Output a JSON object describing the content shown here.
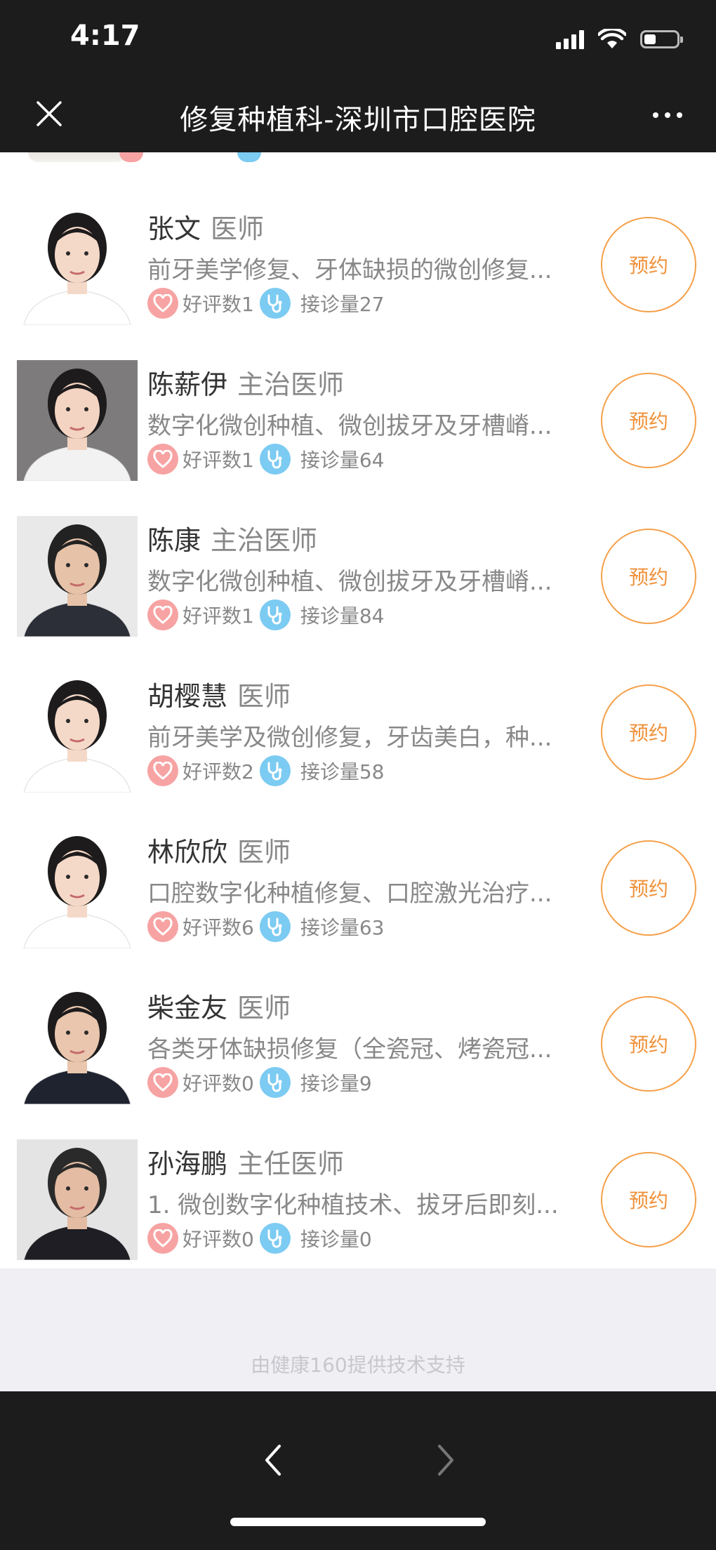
{
  "status_bar": {
    "time": "4:17"
  },
  "nav": {
    "title": "修复种植科-深圳市口腔医院"
  },
  "doctors": [
    {
      "name": "张文",
      "title": "医师",
      "specialty": "前牙美学修复、牙体缺损的微创修复...",
      "good_reviews": "好评数1",
      "visits": "接诊量27",
      "book": "预约",
      "avatar": {
        "bg": "#ffffff",
        "hair": "#1d1b1c",
        "skin": "#f5d9c8",
        "shirt": "#ffffff"
      }
    },
    {
      "name": "陈薪伊",
      "title": "主治医师",
      "specialty": "数字化微创种植、微创拔牙及牙槽嵴...",
      "good_reviews": "好评数1",
      "visits": "接诊量64",
      "book": "预约",
      "avatar": {
        "bg": "#7d7b7b",
        "hair": "#1d1b1c",
        "skin": "#f3d3c1",
        "shirt": "#f2f2f2"
      }
    },
    {
      "name": "陈康",
      "title": "主治医师",
      "specialty": "数字化微创种植、微创拔牙及牙槽嵴...",
      "good_reviews": "好评数1",
      "visits": "接诊量84",
      "book": "预约",
      "avatar": {
        "bg": "#e9e9e9",
        "hair": "#222222",
        "skin": "#e6c2a8",
        "shirt": "#2c2f38"
      }
    },
    {
      "name": "胡樱慧",
      "title": "医师",
      "specialty": "前牙美学及微创修复，牙齿美白，种...",
      "good_reviews": "好评数2",
      "visits": "接诊量58",
      "book": "预约",
      "avatar": {
        "bg": "#ffffff",
        "hair": "#1d1b1c",
        "skin": "#f5d9c8",
        "shirt": "#ffffff"
      }
    },
    {
      "name": "林欣欣",
      "title": "医师",
      "specialty": "口腔数字化种植修复、口腔激光治疗...",
      "good_reviews": "好评数6",
      "visits": "接诊量63",
      "book": "预约",
      "avatar": {
        "bg": "#ffffff",
        "hair": "#1d1b1c",
        "skin": "#f5d9c8",
        "shirt": "#ffffff"
      }
    },
    {
      "name": "柴金友",
      "title": "医师",
      "specialty": "各类牙体缺损修复（全瓷冠、烤瓷冠...",
      "good_reviews": "好评数0",
      "visits": "接诊量9",
      "book": "预约",
      "avatar": {
        "bg": "#ffffff",
        "hair": "#1d1b1c",
        "skin": "#e9c6ad",
        "shirt": "#1f2330"
      }
    },
    {
      "name": "孙海鹏",
      "title": "主任医师",
      "specialty": "1. 微创数字化种植技术、拔牙后即刻...",
      "good_reviews": "好评数0",
      "visits": "接诊量0",
      "book": "预约",
      "avatar": {
        "bg": "#e4e4e4",
        "hair": "#2a2a2a",
        "skin": "#e3bca3",
        "shirt": "#1e1e24"
      }
    }
  ],
  "footer": {
    "powered_by": "由健康160提供技术支持"
  },
  "colors": {
    "accent": "#f0913a",
    "heart": "#f7a3a3",
    "stethoscope": "#7ccbf2",
    "dark_bar": "#1c1c1c"
  }
}
